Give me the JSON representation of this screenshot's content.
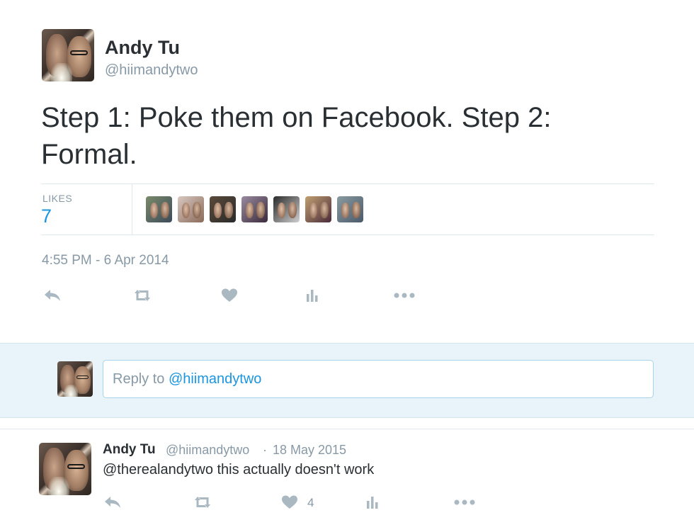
{
  "tweet": {
    "author_name": "Andy Tu",
    "author_handle": "@hiimandytwo",
    "text": "Step 1: Poke them on Facebook. Step 2: Formal.",
    "likes_label": "LIKES",
    "likes_count": "7",
    "timestamp": "4:55 PM - 6 Apr 2014"
  },
  "likers": [
    {
      "name": "liker-avatar-1",
      "colors": [
        "#7a8a6a",
        "#3c4a5a"
      ]
    },
    {
      "name": "liker-avatar-2",
      "colors": [
        "#d8c8c0",
        "#8a6a5a"
      ]
    },
    {
      "name": "liker-avatar-3",
      "colors": [
        "#5a4a3a",
        "#2a2a2a"
      ]
    },
    {
      "name": "liker-avatar-4",
      "colors": [
        "#9a8aa0",
        "#3a2a3a"
      ]
    },
    {
      "name": "liker-avatar-5",
      "colors": [
        "#2a2a2a",
        "#d0d0d0"
      ]
    },
    {
      "name": "liker-avatar-6",
      "colors": [
        "#c0a070",
        "#4a2a3a"
      ]
    },
    {
      "name": "liker-avatar-7",
      "colors": [
        "#8a9aa0",
        "#4a5a6a"
      ]
    }
  ],
  "actions": {
    "reply_icon": "reply-icon",
    "retweet_icon": "retweet-icon",
    "like_icon": "heart-icon",
    "analytics_icon": "analytics-icon",
    "more_icon": "more-icon"
  },
  "reply_box": {
    "prefix": "Reply to ",
    "mention": "@hiimandytwo"
  },
  "reply_tweet": {
    "author_name": "Andy Tu",
    "author_handle": "@hiimandytwo",
    "separator": "·",
    "date": "18 May 2015",
    "text": "@therealandytwo this actually doesn't work",
    "like_count": "4"
  },
  "colors": {
    "link": "#1b95e0",
    "muted": "#8899a6",
    "icon": "#aab8c2",
    "reply_area_bg": "#e8f4f9"
  }
}
